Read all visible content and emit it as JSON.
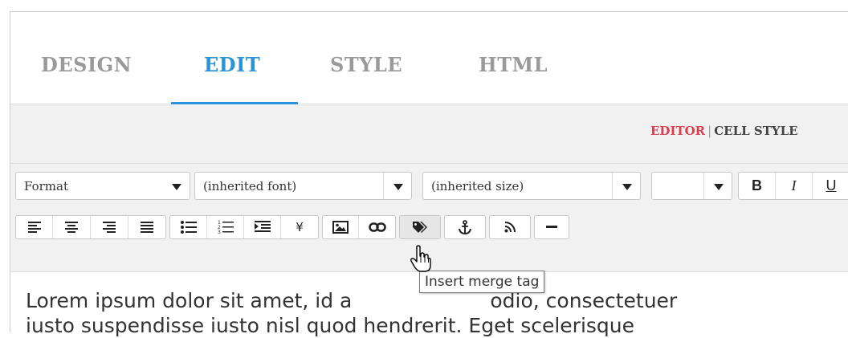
{
  "tabs": [
    {
      "label": "DESIGN",
      "active": false
    },
    {
      "label": "EDIT",
      "active": true
    },
    {
      "label": "STYLE",
      "active": false
    },
    {
      "label": "HTML",
      "active": false
    }
  ],
  "subnav": {
    "editor": "EDITOR",
    "separator": "|",
    "cell_style": "CELL STYLE"
  },
  "toolbar": {
    "format_select": "Format",
    "font_select": "(inherited font)",
    "size_select": "(inherited size)",
    "color_select": "",
    "bold": "B",
    "italic": "I",
    "underline": "U",
    "currency": "¥"
  },
  "tooltip": {
    "text": "Insert merge tag"
  },
  "content": {
    "line1": "Lorem ipsum dolor sit amet, id a",
    "line1_rest": "odio, consectetuer",
    "line2": "iusto suspendisse iusto nisl quod hendrerit. Eget scelerisque"
  },
  "colors": {
    "accent": "#2c93d8",
    "editor_link": "#d9404f"
  }
}
